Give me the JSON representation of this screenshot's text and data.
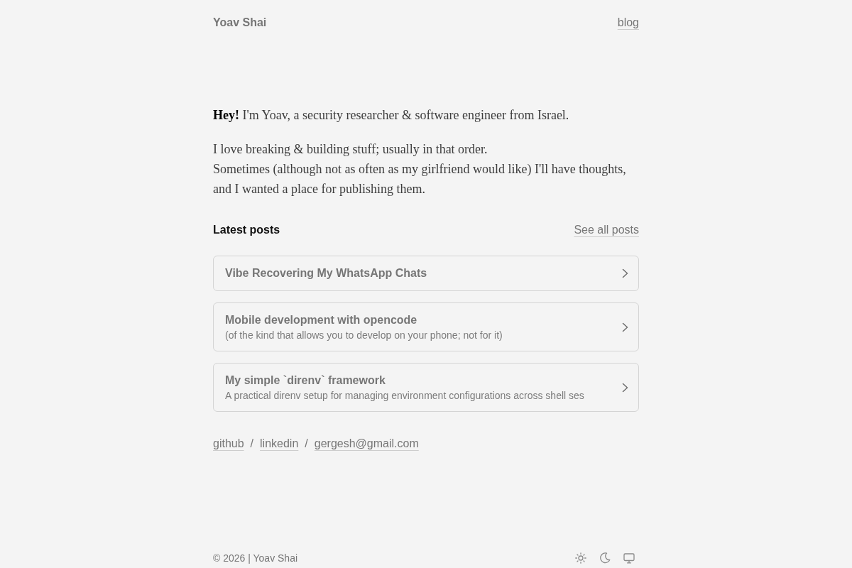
{
  "header": {
    "site_title": "Yoav Shai",
    "nav_link": "blog"
  },
  "intro": {
    "paragraphs": [
      {
        "lines": [
          "**Hey!** I'm Yoav, a security researcher & software engineer from Israel."
        ]
      },
      {
        "lines": [
          "I love breaking & building stuff; usually in that order.",
          "Sometimes (although not as often as my girlfriend would like) I'll have thoughts, and I wanted a place for publishing them."
        ]
      }
    ]
  },
  "latest_posts": {
    "heading": "Latest posts",
    "see_all": "See all posts",
    "posts": [
      {
        "title": "Vibe Recovering My WhatsApp Chats"
      },
      {
        "title": "Mobile development with opencode",
        "description": "(of the kind that allows you to develop on your phone; not for it)"
      },
      {
        "title": "My simple `direnv` framework",
        "description": "A practical direnv setup for managing environment configurations across shell ses"
      }
    ]
  },
  "links": [
    {
      "kind": "link",
      "label": "github"
    },
    {
      "kind": "separator",
      "label": "/"
    },
    {
      "kind": "link",
      "label": "linkedin"
    },
    {
      "kind": "separator",
      "label": "/"
    },
    {
      "kind": "link",
      "label": "gergesh@gmail.com"
    }
  ],
  "footer": {
    "copyright": "© 2026 | Yoav Shai"
  }
}
